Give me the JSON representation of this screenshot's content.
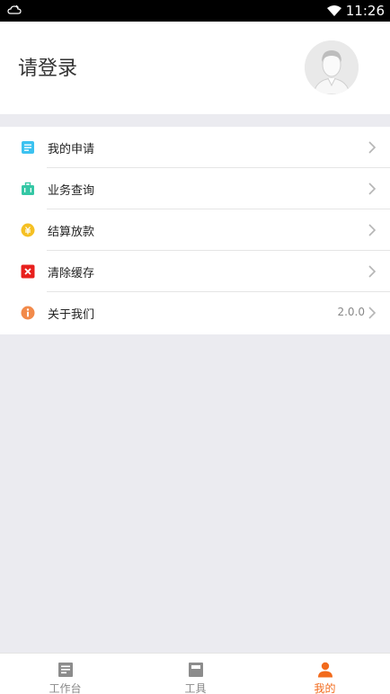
{
  "status_bar": {
    "time": "11:26",
    "icons": [
      "notification-cloud-icon",
      "wifi-icon"
    ]
  },
  "header": {
    "login_text": "请登录",
    "avatar": "default-avatar"
  },
  "menu": [
    {
      "label": "我的申请",
      "icon": "application-doc-icon",
      "icon_color": "#3cc2f0",
      "value": ""
    },
    {
      "label": "业务查询",
      "icon": "briefcase-icon",
      "icon_color": "#35c7a5",
      "value": ""
    },
    {
      "label": "结算放款",
      "icon": "coin-icon",
      "icon_color": "#f5c023",
      "value": ""
    },
    {
      "label": "清除缓存",
      "icon": "clear-x-icon",
      "icon_color": "#e8201d",
      "value": ""
    },
    {
      "label": "关于我们",
      "icon": "info-icon",
      "icon_color": "#f28a4a",
      "value": "2.0.0"
    }
  ],
  "bottom_nav": [
    {
      "label": "工作台",
      "icon": "workbench-icon",
      "active": false
    },
    {
      "label": "工具",
      "icon": "tools-icon",
      "active": false
    },
    {
      "label": "我的",
      "icon": "person-icon",
      "active": true
    }
  ],
  "colors": {
    "accent": "#f26b1d",
    "background": "#ebebf0",
    "inactive_nav": "#888888"
  }
}
